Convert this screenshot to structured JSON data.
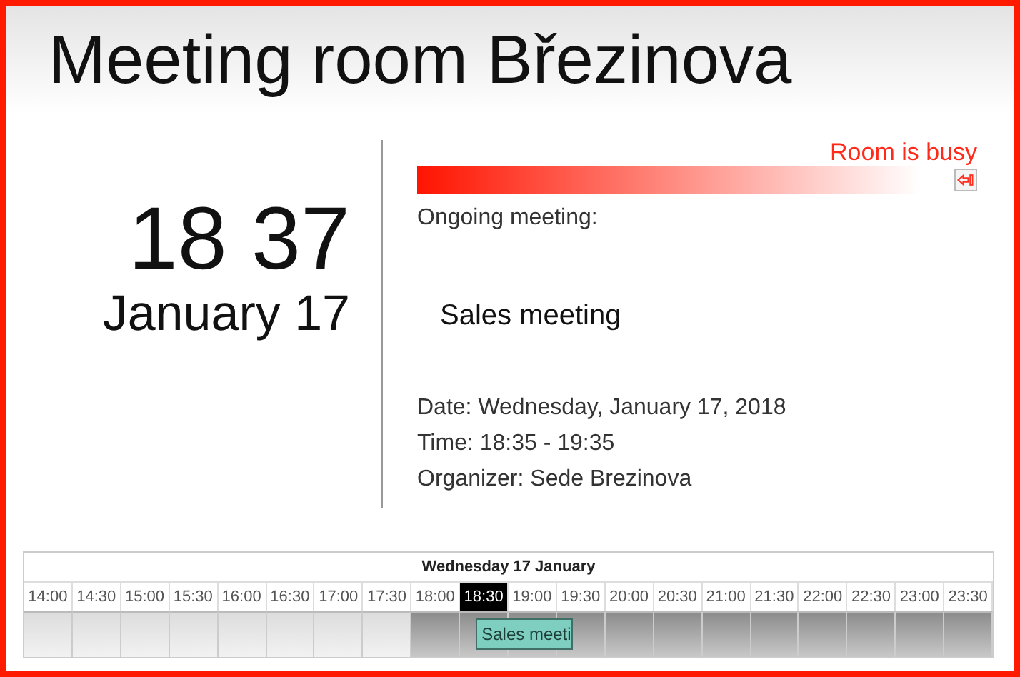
{
  "title": "Meeting room Březinova",
  "clock": {
    "time": "18 37",
    "date": "January 17"
  },
  "status": {
    "text": "Room is busy"
  },
  "meeting": {
    "heading": "Ongoing meeting:",
    "subject": "Sales meeting",
    "details": [
      "Date: Wednesday, January 17, 2018",
      "Time: 18:35 - 19:35",
      "Organizer: Sede Brezinova"
    ]
  },
  "timeline": {
    "day": "Wednesday 17 January",
    "slots": [
      {
        "time": "14:00",
        "selected": false,
        "shaded": false
      },
      {
        "time": "14:30",
        "selected": false,
        "shaded": false
      },
      {
        "time": "15:00",
        "selected": false,
        "shaded": false
      },
      {
        "time": "15:30",
        "selected": false,
        "shaded": false
      },
      {
        "time": "16:00",
        "selected": false,
        "shaded": false
      },
      {
        "time": "16:30",
        "selected": false,
        "shaded": false
      },
      {
        "time": "17:00",
        "selected": false,
        "shaded": false
      },
      {
        "time": "17:30",
        "selected": false,
        "shaded": false
      },
      {
        "time": "18:00",
        "selected": false,
        "shaded": true
      },
      {
        "time": "18:30",
        "selected": true,
        "shaded": true,
        "event": {
          "title": "Sales meeti"
        }
      },
      {
        "time": "19:00",
        "selected": false,
        "shaded": true
      },
      {
        "time": "19:30",
        "selected": false,
        "shaded": true
      },
      {
        "time": "20:00",
        "selected": false,
        "shaded": true
      },
      {
        "time": "20:30",
        "selected": false,
        "shaded": true
      },
      {
        "time": "21:00",
        "selected": false,
        "shaded": true
      },
      {
        "time": "21:30",
        "selected": false,
        "shaded": true
      },
      {
        "time": "22:00",
        "selected": false,
        "shaded": true
      },
      {
        "time": "22:30",
        "selected": false,
        "shaded": true
      },
      {
        "time": "23:00",
        "selected": false,
        "shaded": true
      },
      {
        "time": "23:30",
        "selected": false,
        "shaded": true
      }
    ]
  }
}
